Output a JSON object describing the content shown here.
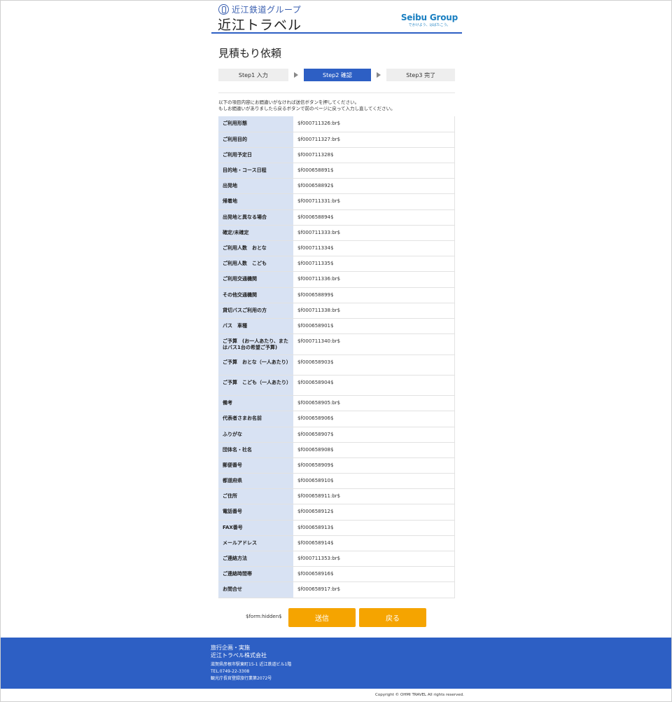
{
  "header": {
    "group_name": "近江鉄道グループ",
    "brand": "近江トラベル",
    "partner_name": "Seibu Group",
    "partner_tagline": "でかけよう、はばたこう。"
  },
  "page_title": "見積もり依頼",
  "steps": [
    {
      "label": "Step1 入力"
    },
    {
      "label": "Step2 確認"
    },
    {
      "label": "Step3 完了"
    }
  ],
  "intro": {
    "line1": "以下の項目内容にお間違いがなければ送信ボタンを押してください。",
    "line2": "もしお間違いがありましたら戻るボタンで前のページに戻って入力し直してください。"
  },
  "rows": [
    {
      "key": "ご利用形態",
      "value": "$f000711326:br$"
    },
    {
      "key": "ご利用目的",
      "value": "$f000711327:br$"
    },
    {
      "key": "ご利用予定日",
      "value": "$f000711328$"
    },
    {
      "key": "目的地・コース日程",
      "value": "$f000658891$"
    },
    {
      "key": "出発地",
      "value": "$f000658892$"
    },
    {
      "key": "帰着地",
      "value": "$f000711331:br$"
    },
    {
      "key": "出発地と異なる場合",
      "value": "$f000658894$"
    },
    {
      "key": "確定/未確定",
      "value": "$f000711333:br$"
    },
    {
      "key": "ご利用人数　おとな",
      "value": "$f000711334$"
    },
    {
      "key": "ご利用人数　こども",
      "value": "$f000711335$"
    },
    {
      "key": "ご利用交通機関",
      "value": "$f000711336:br$"
    },
    {
      "key": "その他交通機関",
      "value": "$f000658899$"
    },
    {
      "key": "貸切バスご利用の方",
      "value": "$f000711338:br$"
    },
    {
      "key": "バス　車種",
      "value": "$f000658901$"
    },
    {
      "key": "ご予算　(お一人あたり、またはバス1台の希望ご予算)",
      "value": "$f000711340:br$"
    },
    {
      "key": "ご予算　おとな（一人あたり）",
      "value": "$f000658903$"
    },
    {
      "key": "ご予算　こども（一人あたり）",
      "value": "$f000658904$"
    },
    {
      "key": "備考",
      "value": "$f000658905:br$"
    },
    {
      "key": "代表者さまお名前",
      "value": "$f000658906$"
    },
    {
      "key": "ふりがな",
      "value": "$f000658907$"
    },
    {
      "key": "団体名・社名",
      "value": "$f000658908$"
    },
    {
      "key": "郵便番号",
      "value": "$f000658909$"
    },
    {
      "key": "都道府県",
      "value": "$f000658910$"
    },
    {
      "key": "ご住所",
      "value": "$f000658911:br$"
    },
    {
      "key": "電話番号",
      "value": "$f000658912$"
    },
    {
      "key": "FAX番号",
      "value": "$f000658913$"
    },
    {
      "key": "メールアドレス",
      "value": "$f000658914$"
    },
    {
      "key": "ご連絡方法",
      "value": "$f000711353:br$"
    },
    {
      "key": "ご連絡時間帯",
      "value": "$f000658916$"
    },
    {
      "key": "お問合せ",
      "value": "$f000658917:br$"
    }
  ],
  "form": {
    "hidden_tag": "$form:hidden$",
    "send_label": "送信",
    "back_label": "戻る"
  },
  "footer": {
    "line1": "旅行企画・実施",
    "company": "近江トラベル株式会社",
    "address": "滋賀県彦根市駅東町15-1 近江鉄道ビル1階",
    "tel": "TEL.0749-22-3308",
    "registration": "観光庁長官登録旅行業第2072号",
    "copyright": "Copyright © OHMI TRAVEL All rights reserved."
  },
  "colors": {
    "primary": "#2d5fc4",
    "accent_button": "#f5a400",
    "label_bg": "#d8e2f3"
  }
}
